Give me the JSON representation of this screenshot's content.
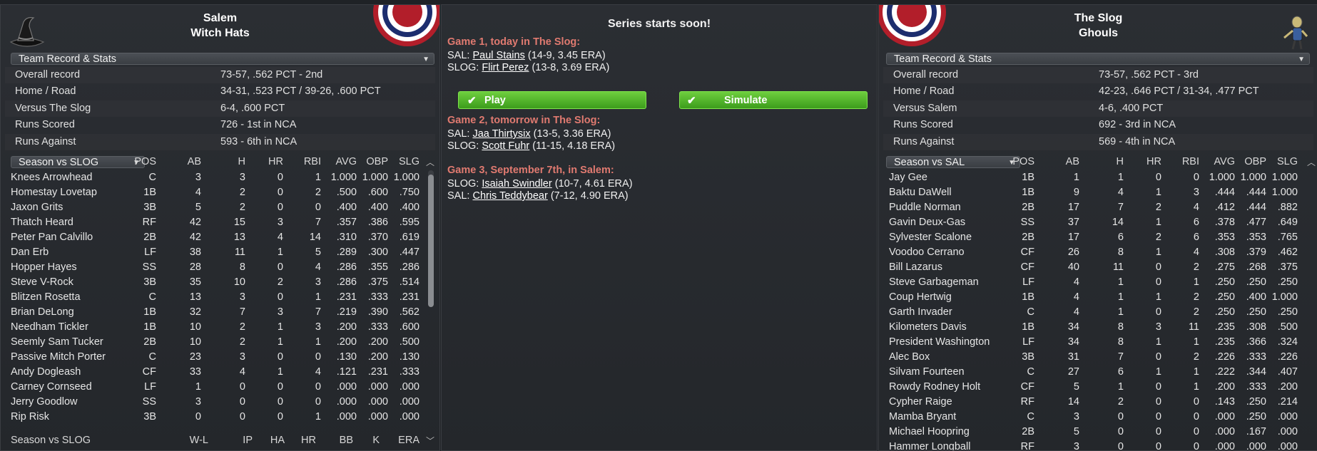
{
  "left": {
    "city": "Salem",
    "name": "Witch Hats",
    "record_dropdown": "Team Record & Stats",
    "stats": [
      {
        "label": "Overall record",
        "value": "73-57, .562 PCT - 2nd"
      },
      {
        "label": "Home / Road",
        "value": "34-31, .523 PCT / 39-26, .600 PCT"
      },
      {
        "label": "Versus The Slog",
        "value": "6-4, .600 PCT"
      },
      {
        "label": "Runs Scored",
        "value": "726 - 1st in NCA"
      },
      {
        "label": "Runs Against",
        "value": "593 - 6th in NCA"
      }
    ],
    "batting_dropdown": "Season vs SLOG",
    "pitching_label": "Season vs SLOG",
    "batting_headers": [
      "POS",
      "AB",
      "H",
      "HR",
      "RBI",
      "AVG",
      "OBP",
      "SLG"
    ],
    "pitching_headers": [
      "W-L",
      "IP",
      "HA",
      "HR",
      "BB",
      "K",
      "ERA"
    ],
    "players": [
      [
        "Knees Arrowhead",
        "C",
        "3",
        "3",
        "0",
        "1",
        "1.000",
        "1.000",
        "1.000"
      ],
      [
        "Homestay Lovetap",
        "1B",
        "4",
        "2",
        "0",
        "2",
        ".500",
        ".600",
        ".750"
      ],
      [
        "Jaxon Grits",
        "3B",
        "5",
        "2",
        "0",
        "0",
        ".400",
        ".400",
        ".400"
      ],
      [
        "Thatch Heard",
        "RF",
        "42",
        "15",
        "3",
        "7",
        ".357",
        ".386",
        ".595"
      ],
      [
        "Peter Pan Calvillo",
        "2B",
        "42",
        "13",
        "4",
        "14",
        ".310",
        ".370",
        ".619"
      ],
      [
        "Dan Erb",
        "LF",
        "38",
        "11",
        "1",
        "5",
        ".289",
        ".300",
        ".447"
      ],
      [
        "Hopper Hayes",
        "SS",
        "28",
        "8",
        "0",
        "4",
        ".286",
        ".355",
        ".286"
      ],
      [
        "Steve V-Rock",
        "3B",
        "35",
        "10",
        "2",
        "3",
        ".286",
        ".375",
        ".514"
      ],
      [
        "Blitzen Rosetta",
        "C",
        "13",
        "3",
        "0",
        "1",
        ".231",
        ".333",
        ".231"
      ],
      [
        "Brian DeLong",
        "1B",
        "32",
        "7",
        "3",
        "7",
        ".219",
        ".390",
        ".562"
      ],
      [
        "Needham Tickler",
        "1B",
        "10",
        "2",
        "1",
        "3",
        ".200",
        ".333",
        ".600"
      ],
      [
        "Seemly Sam Tucker",
        "2B",
        "10",
        "2",
        "1",
        "1",
        ".200",
        ".200",
        ".500"
      ],
      [
        "Passive Mitch Porter",
        "C",
        "23",
        "3",
        "0",
        "0",
        ".130",
        ".200",
        ".130"
      ],
      [
        "Andy Dogleash",
        "CF",
        "33",
        "4",
        "1",
        "4",
        ".121",
        ".231",
        ".333"
      ],
      [
        "Carney Cornseed",
        "LF",
        "1",
        "0",
        "0",
        "0",
        ".000",
        ".000",
        ".000"
      ],
      [
        "Jerry Goodlow",
        "SS",
        "3",
        "0",
        "0",
        "0",
        ".000",
        ".000",
        ".000"
      ],
      [
        "Rip Risk",
        "3B",
        "0",
        "0",
        "0",
        "1",
        ".000",
        ".000",
        ".000"
      ]
    ]
  },
  "middle": {
    "title": "Series starts soon!",
    "games": [
      {
        "header": "Game 1, today in The Slog:",
        "lines": [
          {
            "team": "SAL:",
            "pitcher": "Paul Stains",
            "stats": "(14-9, 3.45 ERA)"
          },
          {
            "team": "SLOG:",
            "pitcher": "Flirt Perez",
            "stats": "(13-8, 3.69 ERA)"
          }
        ]
      },
      {
        "header": "Game 2, tomorrow in The Slog:",
        "lines": [
          {
            "team": "SAL:",
            "pitcher": "Jaa Thirtysix",
            "stats": "(13-5, 3.36 ERA)"
          },
          {
            "team": "SLOG:",
            "pitcher": "Scott Fuhr",
            "stats": "(11-15, 4.18 ERA)"
          }
        ]
      },
      {
        "header": "Game 3, September 7th,  in Salem:",
        "lines": [
          {
            "team": "SLOG:",
            "pitcher": "Isaiah Swindler",
            "stats": "(10-7, 4.61 ERA)"
          },
          {
            "team": "SAL:",
            "pitcher": "Chris Teddybear",
            "stats": "(7-12, 4.90 ERA)"
          }
        ]
      }
    ],
    "play_label": "Play",
    "simulate_label": "Simulate"
  },
  "right": {
    "city": "The Slog",
    "name": "Ghouls",
    "record_dropdown": "Team Record & Stats",
    "stats": [
      {
        "label": "Overall record",
        "value": "73-57, .562 PCT - 3rd"
      },
      {
        "label": "Home / Road",
        "value": "42-23, .646 PCT / 31-34, .477 PCT"
      },
      {
        "label": "Versus Salem",
        "value": "4-6, .400 PCT"
      },
      {
        "label": "Runs Scored",
        "value": "692 - 3rd in NCA"
      },
      {
        "label": "Runs Against",
        "value": "569 - 4th in NCA"
      }
    ],
    "batting_dropdown": "Season vs SAL",
    "batting_headers": [
      "POS",
      "AB",
      "H",
      "HR",
      "RBI",
      "AVG",
      "OBP",
      "SLG"
    ],
    "players": [
      [
        "Jay Gee",
        "1B",
        "1",
        "1",
        "0",
        "0",
        "1.000",
        "1.000",
        "1.000"
      ],
      [
        "Baktu DaWell",
        "1B",
        "9",
        "4",
        "1",
        "3",
        ".444",
        ".444",
        "1.000"
      ],
      [
        "Puddle Norman",
        "2B",
        "17",
        "7",
        "2",
        "4",
        ".412",
        ".444",
        ".882"
      ],
      [
        "Gavin Deux-Gas",
        "SS",
        "37",
        "14",
        "1",
        "6",
        ".378",
        ".477",
        ".649"
      ],
      [
        "Sylvester Scalone",
        "2B",
        "17",
        "6",
        "2",
        "6",
        ".353",
        ".353",
        ".765"
      ],
      [
        "Voodoo Cerrano",
        "CF",
        "26",
        "8",
        "1",
        "4",
        ".308",
        ".379",
        ".462"
      ],
      [
        "Bill Lazarus",
        "CF",
        "40",
        "11",
        "0",
        "2",
        ".275",
        ".268",
        ".375"
      ],
      [
        "Steve Garbageman",
        "LF",
        "4",
        "1",
        "0",
        "1",
        ".250",
        ".250",
        ".250"
      ],
      [
        "Coup Hertwig",
        "1B",
        "4",
        "1",
        "1",
        "2",
        ".250",
        ".400",
        "1.000"
      ],
      [
        "Garth Invader",
        "C",
        "4",
        "1",
        "0",
        "2",
        ".250",
        ".250",
        ".250"
      ],
      [
        "Kilometers Davis",
        "1B",
        "34",
        "8",
        "3",
        "11",
        ".235",
        ".308",
        ".500"
      ],
      [
        "President Washington",
        "LF",
        "34",
        "8",
        "1",
        "1",
        ".235",
        ".366",
        ".324"
      ],
      [
        "Alec Box",
        "3B",
        "31",
        "7",
        "0",
        "2",
        ".226",
        ".333",
        ".226"
      ],
      [
        "Silvam Fourteen",
        "C",
        "27",
        "6",
        "1",
        "1",
        ".222",
        ".344",
        ".407"
      ],
      [
        "Rowdy Rodney Holt",
        "CF",
        "5",
        "1",
        "0",
        "1",
        ".200",
        ".333",
        ".200"
      ],
      [
        "Cypher Raige",
        "RF",
        "14",
        "2",
        "0",
        "0",
        ".143",
        ".250",
        ".214"
      ],
      [
        "Mamba Bryant",
        "C",
        "3",
        "0",
        "0",
        "0",
        ".000",
        ".250",
        ".000"
      ],
      [
        "Michael Hoopring",
        "2B",
        "5",
        "0",
        "0",
        "0",
        ".000",
        ".167",
        ".000"
      ],
      [
        "Hammer Longball",
        "RF",
        "3",
        "0",
        "0",
        "0",
        ".000",
        ".000",
        ".000"
      ]
    ]
  },
  "icons": {
    "left_logo": "witch-hat-icon",
    "right_logo": "ghoul-mascot-icon",
    "bunting": "patriotic-bunting-icon",
    "check": "checkmark-icon",
    "chevron": "chevron-down-icon"
  },
  "colors": {
    "game_header": "#e07a70",
    "button_green": "#4fb52a"
  }
}
